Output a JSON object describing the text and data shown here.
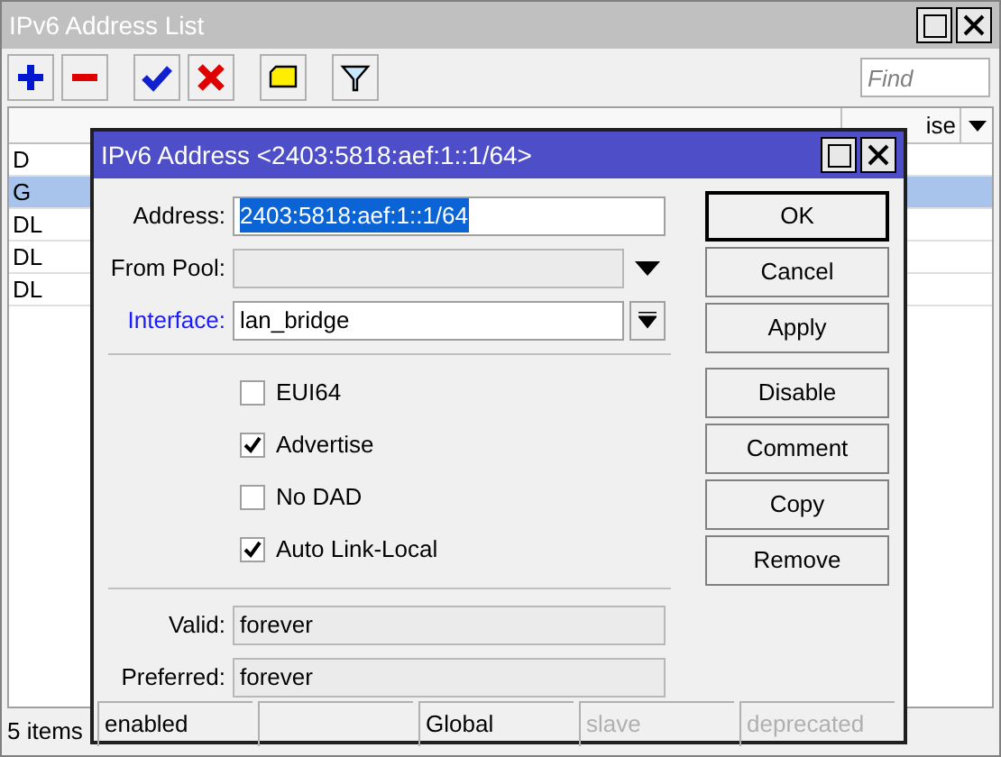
{
  "window": {
    "title": "IPv6 Address List"
  },
  "toolbar": {
    "find_placeholder": "Find"
  },
  "table": {
    "columns": [
      "ise"
    ],
    "rows": [
      {
        "flags": "D",
        "selected": false
      },
      {
        "flags": "G",
        "selected": true
      },
      {
        "flags": "DL",
        "selected": false
      },
      {
        "flags": "DL",
        "selected": false
      },
      {
        "flags": "DL",
        "selected": false
      }
    ]
  },
  "status_bar": "5 items",
  "dialog": {
    "title": "IPv6 Address <2403:5818:aef:1::1/64>",
    "fields": [
      {
        "kind": "text",
        "label": "Address:",
        "value": "2403:5818:aef:1::1/64",
        "highlighted": false
      },
      {
        "kind": "pool",
        "label": "From Pool:",
        "highlighted": false
      },
      {
        "kind": "interface",
        "label": "Interface:",
        "value": "lan_bridge",
        "highlighted": true
      }
    ],
    "address_text_selected": true,
    "checkboxes": [
      {
        "label": "EUI64",
        "checked": false
      },
      {
        "label": "Advertise",
        "checked": true
      },
      {
        "label": "No DAD",
        "checked": false
      },
      {
        "label": "Auto Link-Local",
        "checked": true
      }
    ],
    "info_fields": [
      {
        "label": "Valid:",
        "value": "forever"
      },
      {
        "label": "Preferred:",
        "value": "forever"
      }
    ],
    "buttons": [
      {
        "label": "OK",
        "default": true
      },
      {
        "label": "Cancel",
        "default": false
      },
      {
        "label": "Apply",
        "default": false
      },
      {
        "label": "Disable",
        "default": false
      },
      {
        "label": "Comment",
        "default": false
      },
      {
        "label": "Copy",
        "default": false
      },
      {
        "label": "Remove",
        "default": false
      }
    ],
    "status": [
      {
        "kind": "text",
        "text": "enabled",
        "active": true
      },
      {
        "kind": "blank"
      },
      {
        "kind": "text",
        "text": "Global",
        "active": true
      },
      {
        "kind": "text",
        "text": "slave",
        "active": false
      },
      {
        "kind": "text",
        "text": "deprecated",
        "active": false
      }
    ]
  }
}
